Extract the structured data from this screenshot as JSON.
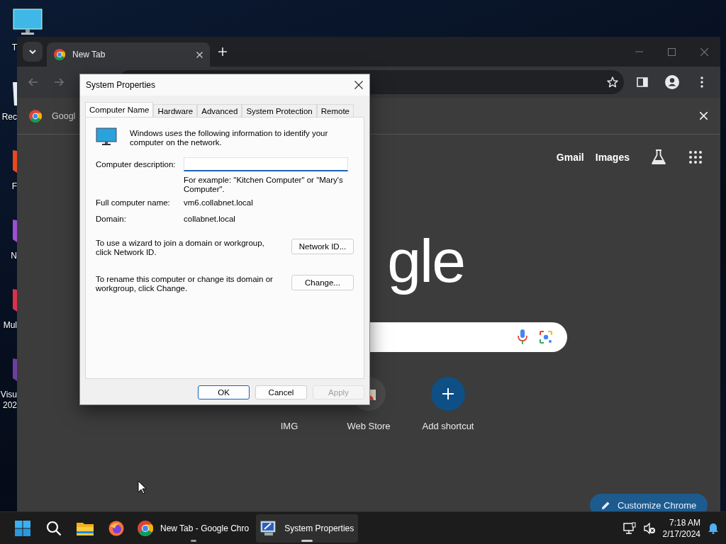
{
  "desktop": {
    "icons": [
      {
        "kind": "monitor",
        "label": "T"
      },
      {
        "kind": "bin",
        "label": "Rec"
      },
      {
        "kind": "app",
        "label": "F",
        "color": "#e8491d"
      },
      {
        "kind": "app",
        "label": "N",
        "color": "#9c4fd6"
      },
      {
        "kind": "app",
        "label": "Mul",
        "color": "#d8334a"
      },
      {
        "kind": "app",
        "label": "Visu 202",
        "color": "#6b3fa0"
      }
    ]
  },
  "browser": {
    "tabs": [
      {
        "title": "New Tab",
        "selected": true
      }
    ],
    "nav_buttons": [
      {
        "kind": "back",
        "disabled": true
      },
      {
        "kind": "forward",
        "disabled": true
      }
    ],
    "infobar": {
      "text": "Googl"
    },
    "header_links": [
      "Gmail",
      "Images"
    ],
    "logo": "gle",
    "shortcuts": [
      {
        "kind": "site",
        "label": "IMG"
      },
      {
        "kind": "store",
        "label": "Web Store"
      },
      {
        "kind": "add",
        "label": "Add shortcut"
      }
    ],
    "customize_button": "Customize Chrome"
  },
  "dialog": {
    "title": "System Properties",
    "tabs": [
      {
        "label": "Computer Name",
        "selected": true
      },
      {
        "label": "Hardware",
        "selected": false
      },
      {
        "label": "Advanced",
        "selected": false
      },
      {
        "label": "System Protection",
        "selected": false
      },
      {
        "label": "Remote",
        "selected": false
      }
    ],
    "intro": "Windows uses the following information to identify your computer on the network.",
    "description_label": "Computer description:",
    "example": "For example: \"Kitchen Computer\" or \"Mary's Computer\".",
    "fields": [
      {
        "label": "Full computer name:",
        "value": "vm6.collabnet.local"
      },
      {
        "label": "Domain:",
        "value": "collabnet.local"
      }
    ],
    "actions": [
      {
        "text": "To use a wizard to join a domain or workgroup, click Network ID.",
        "button": "Network ID..."
      },
      {
        "text": "To rename this computer or change its domain or workgroup, click Change.",
        "button": "Change..."
      }
    ],
    "buttons": [
      {
        "label": "OK",
        "default": true,
        "disabled": false
      },
      {
        "label": "Cancel",
        "default": false,
        "disabled": false
      },
      {
        "label": "Apply",
        "default": false,
        "disabled": true
      }
    ]
  },
  "taskbar": {
    "apps": [
      {
        "kind": "start",
        "running": false,
        "selected": false
      },
      {
        "kind": "search",
        "running": false,
        "selected": false
      },
      {
        "kind": "explorer",
        "running": false,
        "selected": false
      },
      {
        "kind": "firefox",
        "running": false,
        "selected": false
      },
      {
        "kind": "chrome",
        "label": "New Tab - Google Chro",
        "running": true,
        "selected": false
      },
      {
        "kind": "system",
        "label": "System Properties",
        "running": true,
        "selected": true
      }
    ],
    "time": "7:18 AM",
    "date": "2/17/2024"
  }
}
